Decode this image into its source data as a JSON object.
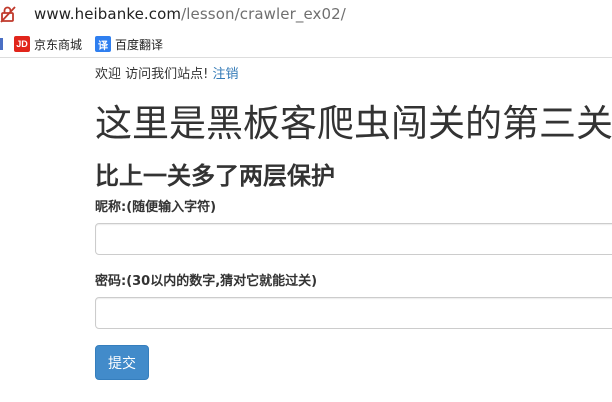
{
  "browser": {
    "url_host": "www.heibanke.com",
    "url_path": "/lesson/crawler_ex02/",
    "bookmarks": [
      {
        "icon": "JD",
        "label": "京东商城"
      },
      {
        "icon": "译",
        "label": "百度翻译"
      }
    ]
  },
  "page": {
    "welcome_text": "欢迎 访问我们站点!",
    "logout_link": "注销",
    "title": "这里是黑板客爬虫闯关的第三关",
    "subtitle": "比上一关多了两层保护",
    "form": {
      "nickname_label": "昵称:(随便输入字符)",
      "nickname_value": "",
      "password_label": "密码:(30以内的数字,猜对它就能过关)",
      "password_value": "",
      "submit_label": "提交"
    }
  },
  "colors": {
    "link": "#337ab7",
    "submit_bg": "#428bca",
    "jd_red": "#e1251b",
    "translate_blue": "#2f7ff0"
  }
}
